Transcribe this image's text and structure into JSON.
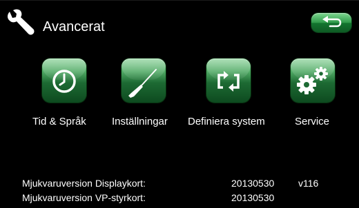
{
  "header": {
    "title": "Avancerat",
    "back_icon": "return-arrow-icon",
    "title_icon": "wrench-icon"
  },
  "menu": {
    "items": [
      {
        "label": "Tid & Språk",
        "icon": "clock-icon"
      },
      {
        "label": "Inställningar",
        "icon": "screwdriver-icon"
      },
      {
        "label": "Definiera system",
        "icon": "cycle-arrows-icon"
      },
      {
        "label": "Service",
        "icon": "gears-icon"
      }
    ]
  },
  "versions": {
    "display_label": "Mjukvaruversion Displaykort:",
    "display_value": "20130530",
    "display_version": "v116",
    "vp_label": "Mjukvaruversion VP-styrkort:",
    "vp_value": "20130530"
  },
  "colors": {
    "background": "#000000",
    "accent_green": "#2f9a4a",
    "text": "#ffffff"
  }
}
